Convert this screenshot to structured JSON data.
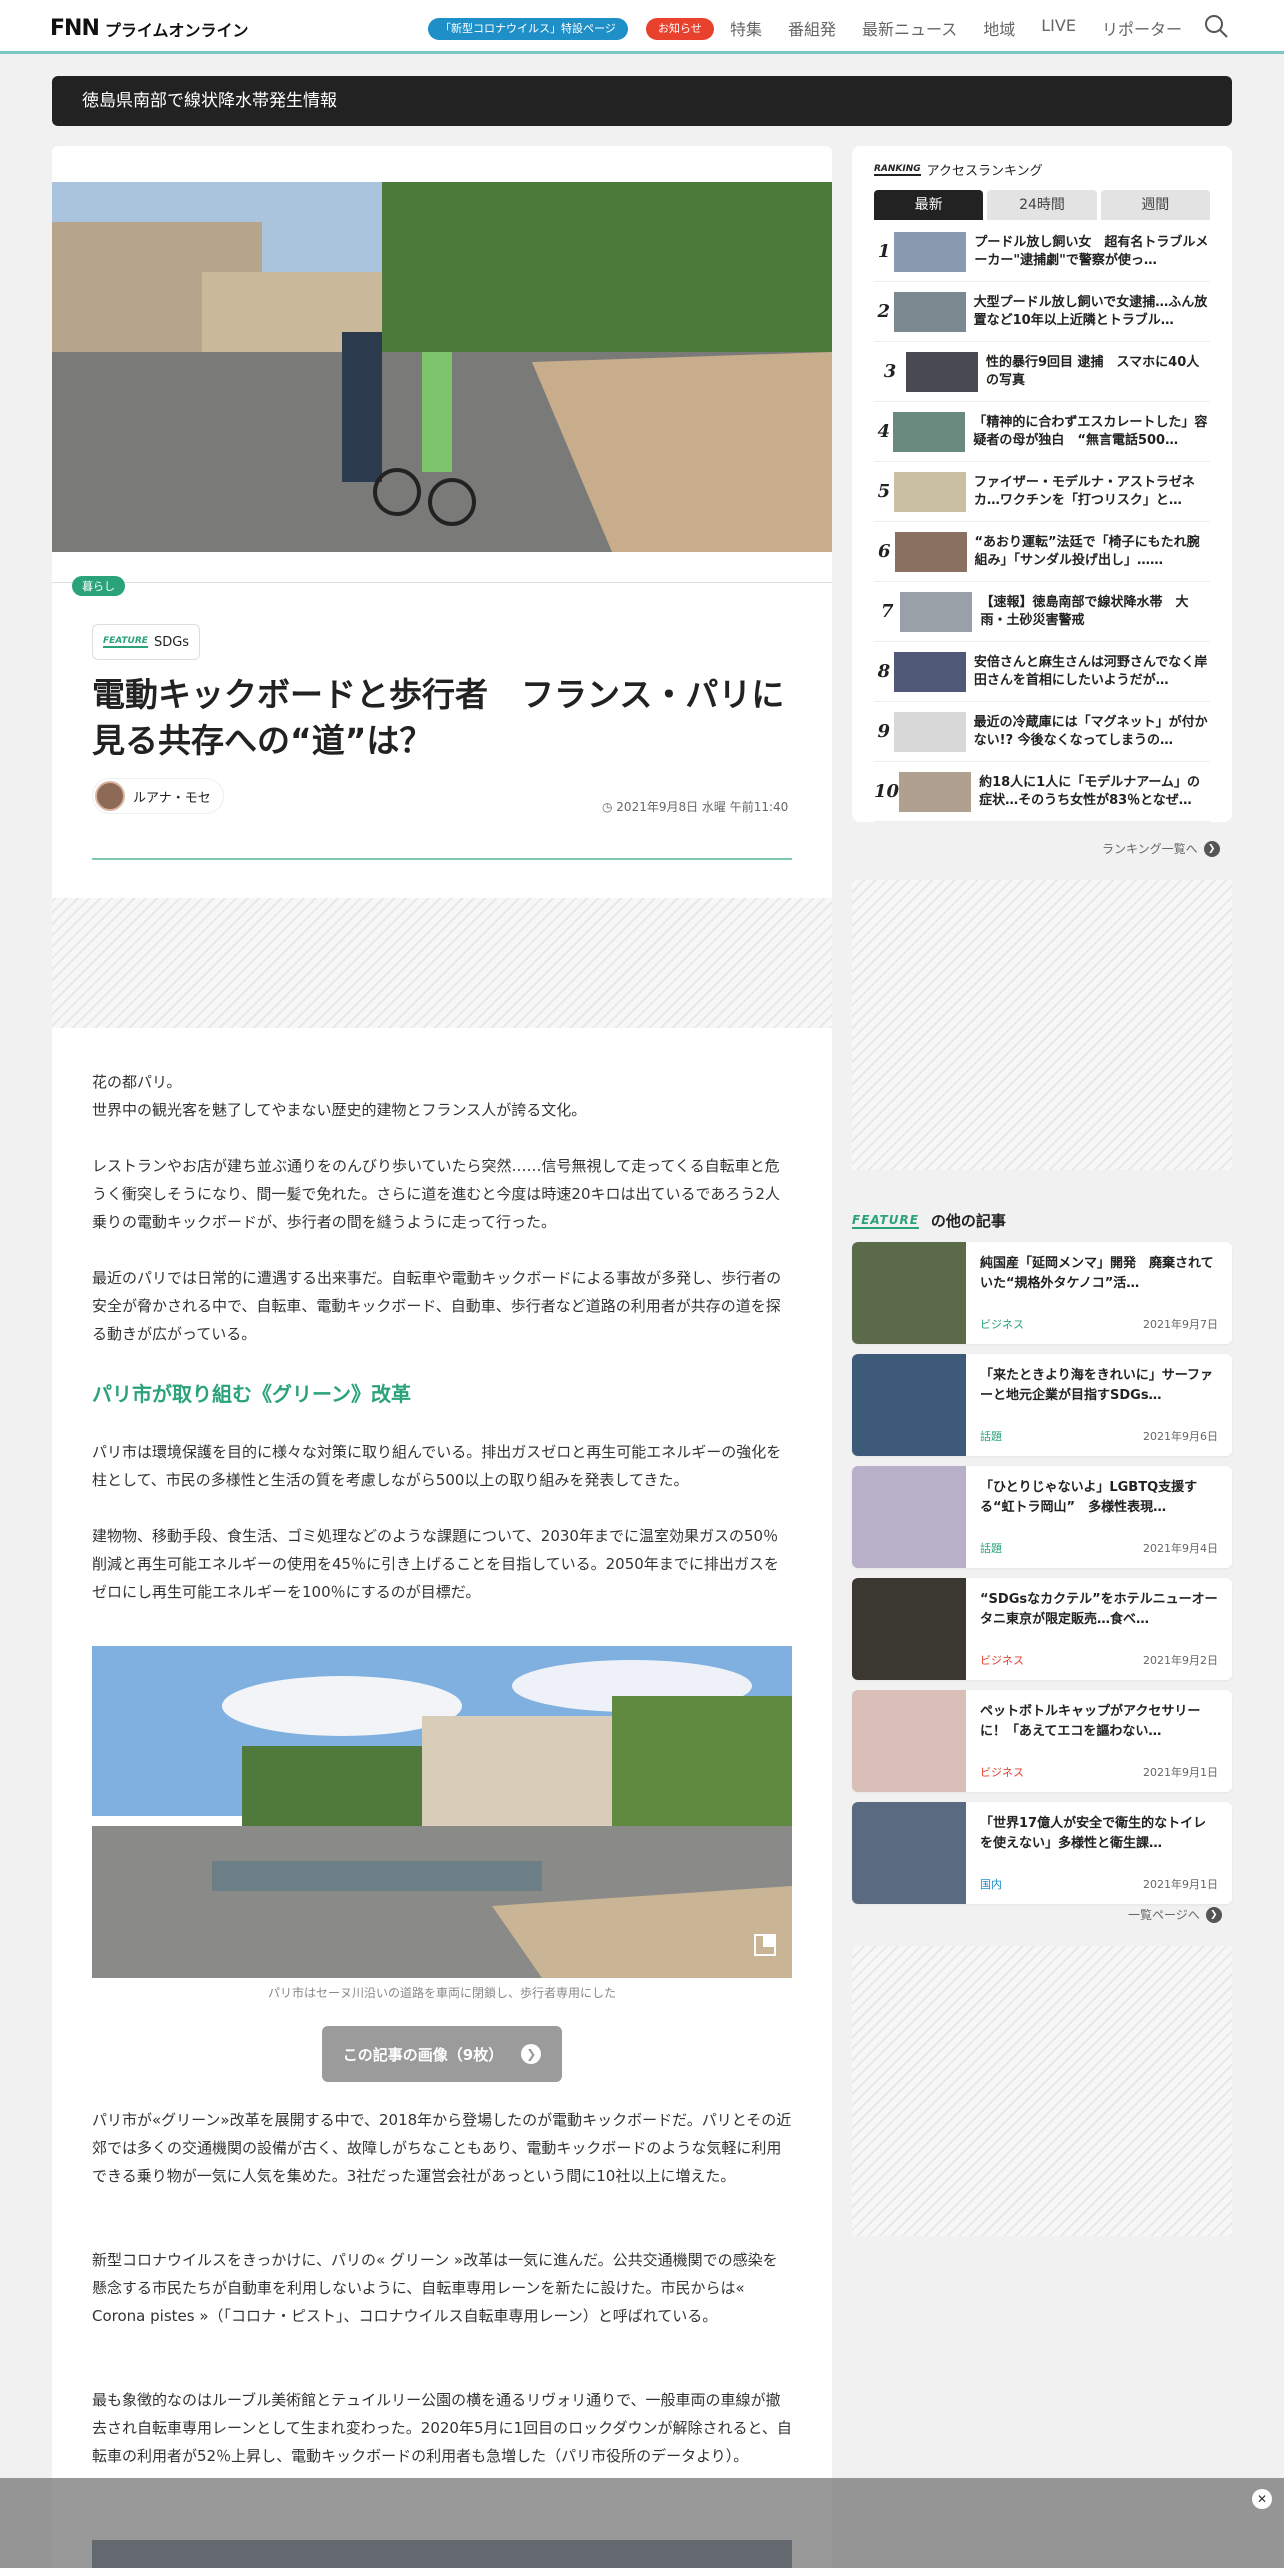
{
  "header": {
    "logo_main": "FNN",
    "logo_sub": "プライムオンライン",
    "corona_pill": "「新型コロナウイルス」特設ページ",
    "notice_pill": "お知らせ",
    "nav": [
      "特集",
      "番組発",
      "最新ニュース",
      "地域",
      "LIVE",
      "リポーター"
    ]
  },
  "breaking": "徳島県南部で線状降水帯発生情報",
  "article": {
    "category": "暮らし",
    "feature_word": "FEATURE",
    "feature_name": "SDGs",
    "title": "電動キックボードと歩行者　フランス・パリに見る共存への“道”は？",
    "author": "ルアナ・モセ",
    "date": "2021年9月8日 水曜 午前11:40",
    "paragraphs": [
      "花の都パリ。\n世界中の観光客を魅了してやまない歴史的建物とフランス人が誇る文化。",
      "レストランやお店が建ち並ぶ通りをのんびり歩いていたら突然……信号無視して走ってくる自転車と危うく衝突しそうになり、間一髪で免れた。さらに道を進むと今度は時速20キロは出ているであろう2人乗りの電動キックボードが、歩行者の間を縫うように走って行った。",
      "最近のパリでは日常的に遭遇する出来事だ。自転車や電動キックボードによる事故が多発し、歩行者の安全が脅かされる中で、自転車、電動キックボード、自動車、歩行者など道路の利用者が共存の道を探る動きが広がっている。"
    ],
    "section_heading": "パリ市が取り組む《グリーン》改革",
    "section_paragraphs": [
      "パリ市は環境保護を目的に様々な対策に取り組んでいる。排出ガスゼロと再生可能エネルギーの強化を柱として、市民の多様性と生活の質を考慮しながら500以上の取り組みを発表してきた。",
      "建物物、移動手段、食生活、ゴミ処理などのような課題について、2030年までに温室効果ガスの50％削減と再生可能エネルギーの使用を45％に引き上げることを目指している。2050年までに排出ガスをゼロにし再生可能エネルギーを100％にするのが目標だ。"
    ],
    "image_caption": "パリ市はセーヌ川沿いの道路を車両に閉鎖し、歩行者専用にした",
    "gallery_button": "この記事の画像（9枚）",
    "later_paragraphs": [
      "パリ市が«グリーン»改革を展開する中で、2018年から登場したのが電動キックボードだ。パリとその近郊では多くの交通機関の設備が古く、故障しがちなこともあり、電動キックボードのような気軽に利用できる乗り物が一気に人気を集めた。3社だった運営会社があっという間に10社以上に増えた。",
      "新型コロナウイルスをきっかけに、パリの« グリーン »改革は一気に進んだ。公共交通機関での感染を懸念する市民たちが自動車を利用しないように、自転車専用レーンを新たに設けた。市民からは« Corona pistes »（「コロナ・ピスト」、コロナウイルス自転車専用レーン）と呼ばれている。",
      "最も象徴的なのはルーブル美術館とテュイルリー公園の横を通るリヴォリ通りで、一般車両の車線が撤去され自転車専用レーンとして生まれ変わった。2020年5月に1回目のロックダウンが解除されると、自転車の利用者が52％上昇し、電動キックボードの利用者も急増した（パリ市役所のデータより）。"
    ]
  },
  "ranking": {
    "ranking_word": "RANKING",
    "heading": "アクセスランキング",
    "tabs": [
      "最新",
      "24時間",
      "週間"
    ],
    "items": [
      {
        "rank": "1",
        "text": "プードル放し飼い女　超有名トラブルメーカー\"逮捕劇\"で警察が使っ…"
      },
      {
        "rank": "2",
        "text": "大型プードル放し飼いで女逮捕…ふん放置など10年以上近隣とトラブル…"
      },
      {
        "rank": "3",
        "text": "性的暴行9回目 逮捕　スマホに40人の写真"
      },
      {
        "rank": "4",
        "text": "「精神的に合わずエスカレートした」容疑者の母が独白　“無言電話500…"
      },
      {
        "rank": "5",
        "text": "ファイザー・モデルナ・アストラゼネカ…ワクチンを「打つリスク」と…"
      },
      {
        "rank": "6",
        "text": "“あおり運転”法廷で「椅子にもたれ腕組み」「サンダル投げ出し」……"
      },
      {
        "rank": "7",
        "text": "【速報】徳島南部で線状降水帯　大雨・土砂災害警戒"
      },
      {
        "rank": "8",
        "text": "安倍さんと麻生さんは河野さんでなく岸田さんを首相にしたいようだが…"
      },
      {
        "rank": "9",
        "text": "最近の冷蔵庫には「マグネット」が付かない!? 今後なくなってしまうの…"
      },
      {
        "rank": "10",
        "text": "約18人に1人に「モデルナアーム」の症状…そのうち女性が83％となぜ…"
      }
    ],
    "more_label": "ランキング一覧へ"
  },
  "features": {
    "feature_word": "FEATURE",
    "heading": "の他の記事",
    "items": [
      {
        "text": "純国産「延岡メンマ」開発　廃棄されていた“規格外タケノコ”活…",
        "category": "ビジネス",
        "date": "2021年9月7日",
        "cat_color": "#2aa27a",
        "thumb": "#5b6b4a"
      },
      {
        "text": "「来たときより海をきれいに」サーファーと地元企業が目指すSDGs…",
        "category": "話題",
        "date": "2021年9月6日",
        "cat_color": "#2aa27a",
        "thumb": "#3d5a7a"
      },
      {
        "text": "「ひとりじゃないよ」LGBTQ支援する“虹トラ岡山”　多様性表現…",
        "category": "話題",
        "date": "2021年9月4日",
        "cat_color": "#2aa27a",
        "thumb": "#b8b0c8"
      },
      {
        "text": "“SDGsなカクテル”をホテルニューオータニ東京が限定販売…食べ…",
        "category": "ビジネス",
        "date": "2021年9月2日",
        "cat_color": "#e8412e",
        "thumb": "#3a3830"
      },
      {
        "text": "ペットボトルキャップがアクセサリーに！「あえてエコを謳わない…",
        "category": "ビジネス",
        "date": "2021年9月1日",
        "cat_color": "#e8412e",
        "thumb": "#d8c0b8"
      },
      {
        "text": "「世界17億人が安全で衛生的なトイレを使えない」多様性と衛生課…",
        "category": "国内",
        "date": "2021年9月1日",
        "cat_color": "#1f8fc8",
        "thumb": "#5a6a80"
      }
    ],
    "more_label": "一覧ページへ"
  }
}
